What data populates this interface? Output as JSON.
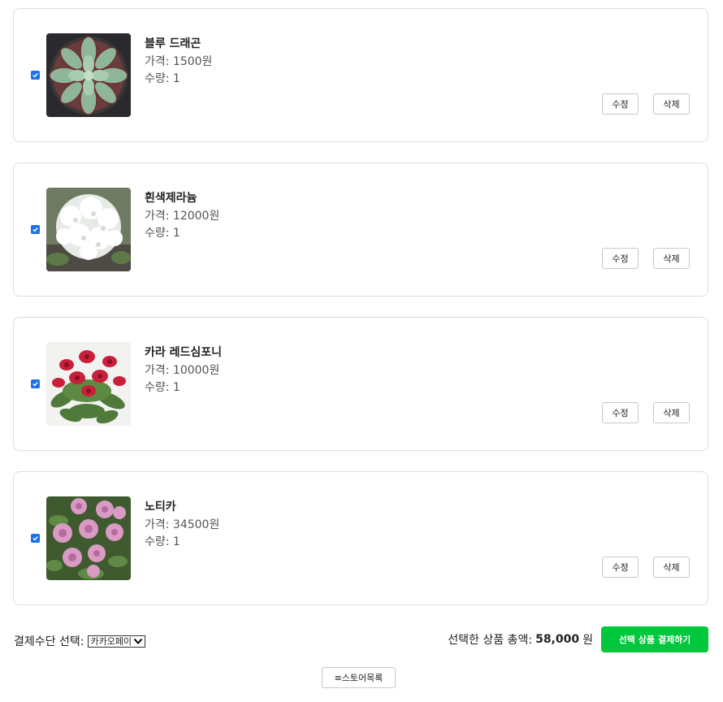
{
  "cart": {
    "items": [
      {
        "name": "블루 드래곤",
        "price": "가격: 1500원",
        "qty": "수량: 1",
        "checked": true,
        "image": "succulent-photo"
      },
      {
        "name": "흰색제라늄",
        "price": "가격: 12000원",
        "qty": "수량: 1",
        "checked": true,
        "image": "white-geranium-photo"
      },
      {
        "name": "카라 레드심포니",
        "price": "가격: 10000원",
        "qty": "수량: 1",
        "checked": true,
        "image": "red-calla-photo"
      },
      {
        "name": "노티카",
        "price": "가격: 34500원",
        "qty": "수량: 1",
        "checked": true,
        "image": "pink-rose-photo"
      }
    ],
    "edit_label": "수정",
    "delete_label": "삭제"
  },
  "payment": {
    "method_label": "결제수단 선택:",
    "method_value": "카카오페이",
    "total_label": "선택한 상품 총액:",
    "total_amount": "58,000",
    "total_unit": "원",
    "pay_button": "선택 상품 결제하기"
  },
  "store_button": "≡스토어목록",
  "colors": {
    "accent": "#00c73c",
    "checkbox": "#1a73e8"
  }
}
